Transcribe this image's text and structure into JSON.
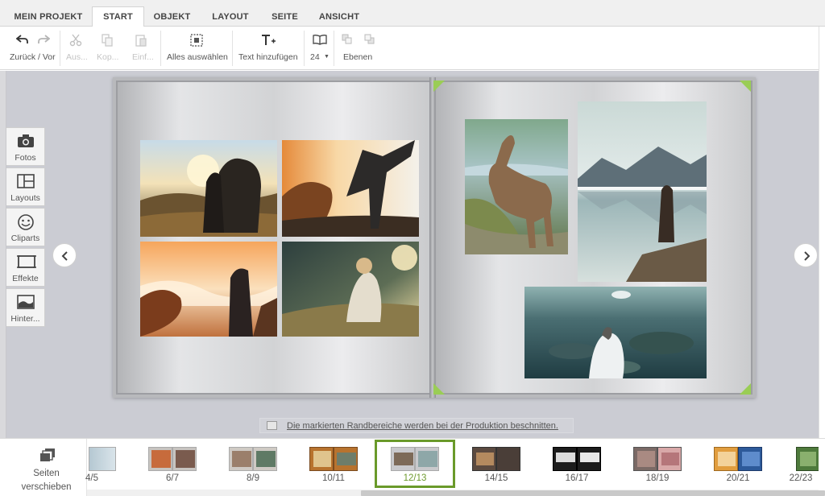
{
  "tabs": [
    {
      "label": "MEIN PROJEKT",
      "active": false
    },
    {
      "label": "START",
      "active": true
    },
    {
      "label": "OBJEKT",
      "active": false
    },
    {
      "label": "LAYOUT",
      "active": false
    },
    {
      "label": "SEITE",
      "active": false
    },
    {
      "label": "ANSICHT",
      "active": false
    }
  ],
  "ribbon": {
    "undo_label": "Zurück / Vor",
    "cut_label": "Aus...",
    "copy_label": "Kop...",
    "paste_label": "Einf...",
    "select_all_label": "Alles auswählen",
    "add_text_label": "Text hinzufügen",
    "zoom_value": "24",
    "layers_label": "Ebenen"
  },
  "tools": [
    {
      "label": "Fotos",
      "icon": "camera-icon"
    },
    {
      "label": "Layouts",
      "icon": "layout-icon"
    },
    {
      "label": "Cliparts",
      "icon": "smiley-icon"
    },
    {
      "label": "Effekte",
      "icon": "frame-icon"
    },
    {
      "label": "Hinter...",
      "icon": "landscape-icon"
    }
  ],
  "info_text": "Die markierten Randbereiche werden bei der Produktion beschnitten.",
  "reorder": {
    "line1": "Seiten",
    "line2": "verschieben"
  },
  "thumbnails": [
    {
      "label": "4/5",
      "active": false
    },
    {
      "label": "6/7",
      "active": false
    },
    {
      "label": "8/9",
      "active": false
    },
    {
      "label": "10/11",
      "active": false
    },
    {
      "label": "12/13",
      "active": true
    },
    {
      "label": "14/15",
      "active": false
    },
    {
      "label": "16/17",
      "active": false
    },
    {
      "label": "18/19",
      "active": false
    },
    {
      "label": "20/21",
      "active": false
    },
    {
      "label": "22/23",
      "active": false
    }
  ],
  "colors": {
    "accent_green": "#6a9a2a",
    "corner_green": "#9acd55",
    "workspace": "#cbccd3"
  }
}
